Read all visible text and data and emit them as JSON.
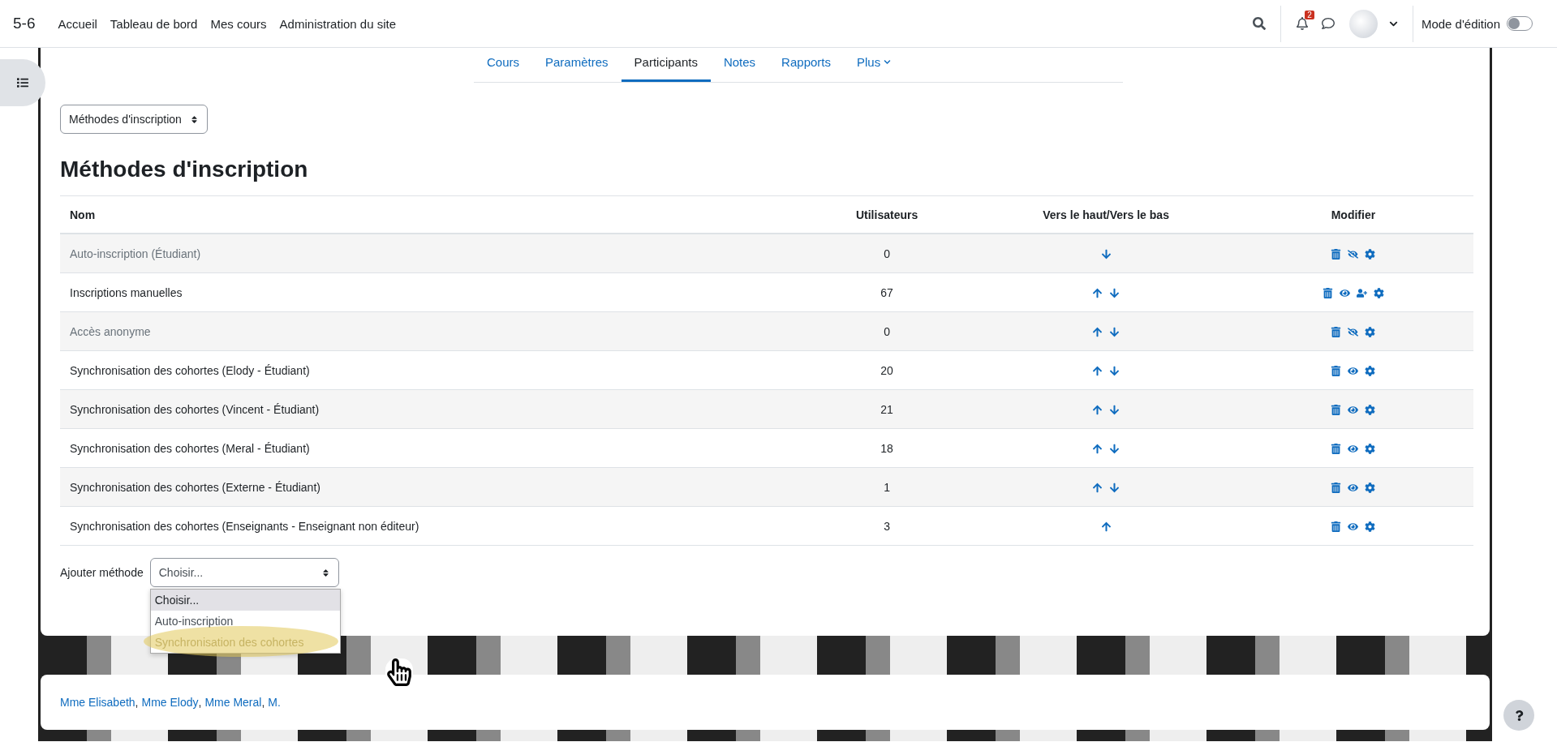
{
  "navbar": {
    "site": "5-6",
    "links": [
      {
        "label": "Accueil"
      },
      {
        "label": "Tableau de bord"
      },
      {
        "label": "Mes cours"
      },
      {
        "label": "Administration du site"
      }
    ],
    "notification_count": "2",
    "edit_mode": {
      "label": "Mode d'édition",
      "on": false
    }
  },
  "tabs": [
    {
      "label": "Cours",
      "selected": false
    },
    {
      "label": "Paramètres",
      "selected": false
    },
    {
      "label": "Participants",
      "selected": true
    },
    {
      "label": "Notes",
      "selected": false
    },
    {
      "label": "Rapports",
      "selected": false
    },
    {
      "label": "Plus",
      "selected": false,
      "menu": true
    }
  ],
  "page_select": "Méthodes d'inscription",
  "title": "Méthodes d'inscription",
  "table": {
    "columns": [
      "Nom",
      "Utilisateurs",
      "Vers le haut/Vers le bas",
      "Modifier"
    ],
    "rows": [
      {
        "name": "Auto-inscription (Étudiant)",
        "users": "0",
        "enabled": false,
        "up": false,
        "down": true,
        "enrol_users": false
      },
      {
        "name": "Inscriptions manuelles",
        "users": "67",
        "enabled": true,
        "up": true,
        "down": true,
        "enrol_users": true
      },
      {
        "name": "Accès anonyme",
        "users": "0",
        "enabled": false,
        "up": true,
        "down": true,
        "enrol_users": false
      },
      {
        "name": "Synchronisation des cohortes (Elody - Étudiant)",
        "users": "20",
        "enabled": true,
        "up": true,
        "down": true,
        "enrol_users": false
      },
      {
        "name": "Synchronisation des cohortes (Vincent - Étudiant)",
        "users": "21",
        "enabled": true,
        "up": true,
        "down": true,
        "enrol_users": false
      },
      {
        "name": "Synchronisation des cohortes (Meral - Étudiant)",
        "users": "18",
        "enabled": true,
        "up": true,
        "down": true,
        "enrol_users": false
      },
      {
        "name": "Synchronisation des cohortes (Externe - Étudiant)",
        "users": "1",
        "enabled": true,
        "up": true,
        "down": true,
        "enrol_users": false
      },
      {
        "name": "Synchronisation des cohortes (Enseignants - Enseignant non éditeur)",
        "users": "3",
        "enabled": true,
        "up": true,
        "down": false,
        "enrol_users": false
      }
    ]
  },
  "add_method": {
    "label": "Ajouter méthode",
    "value": "Choisir...",
    "expanded": true,
    "options": [
      {
        "label": "Choisir...",
        "selected": true,
        "clicked": false
      },
      {
        "label": "Auto-inscription",
        "selected": false,
        "clicked": false
      },
      {
        "label": "Synchronisation des cohortes",
        "selected": false,
        "clicked": true
      }
    ]
  },
  "footer_links": [
    {
      "label": "Mme Elisabeth",
      "separator": ","
    },
    {
      "label": "Mme Elody",
      "separator": ","
    },
    {
      "label": "Mme Meral",
      "separator": ","
    },
    {
      "label": "M."
    }
  ]
}
